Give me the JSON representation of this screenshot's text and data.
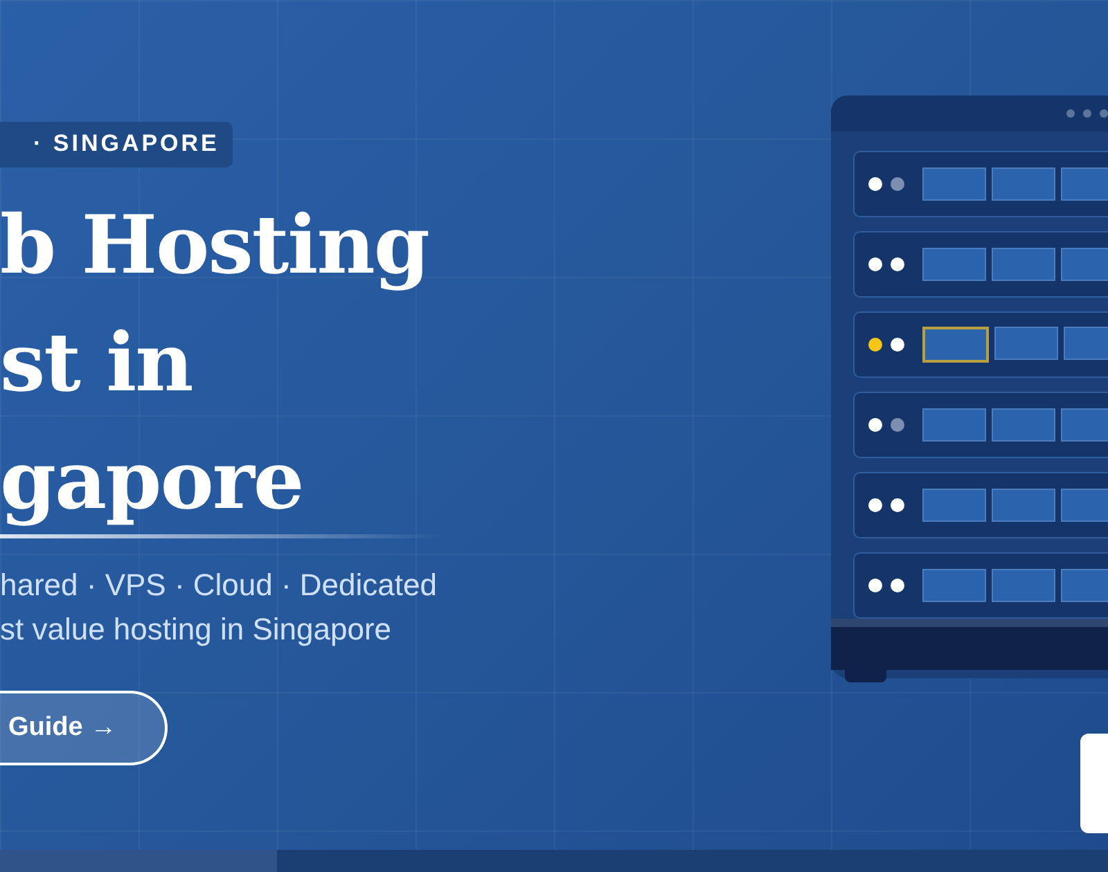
{
  "hero": {
    "badge": "· SINGAPORE",
    "title_lines": [
      "b Hosting",
      "st in",
      "gapore"
    ],
    "subtitle_lines": [
      "hared · VPS · Cloud · Dedicated",
      "st value hosting in Singapore"
    ],
    "cta": "Guide →"
  },
  "rack": {
    "rows": [
      {
        "leds": [
          {
            "color": "#ffffff"
          },
          {
            "color": "#7d8fb0"
          }
        ],
        "warning": false
      },
      {
        "leds": [
          {
            "color": "#ffffff"
          },
          {
            "color": "#ffffff"
          }
        ],
        "warning": false
      },
      {
        "leds": [
          {
            "color": "#f5c518"
          },
          {
            "color": "#ffffff"
          }
        ],
        "warning": true
      },
      {
        "leds": [
          {
            "color": "#ffffff"
          },
          {
            "color": "#7d8fb0"
          }
        ],
        "warning": false
      },
      {
        "leds": [
          {
            "color": "#ffffff"
          },
          {
            "color": "#ffffff"
          }
        ],
        "warning": false
      },
      {
        "leds": [
          {
            "color": "#ffffff"
          },
          {
            "color": "#ffffff"
          }
        ],
        "warning": false
      }
    ]
  },
  "slide_progress": {
    "level": 0.25
  }
}
